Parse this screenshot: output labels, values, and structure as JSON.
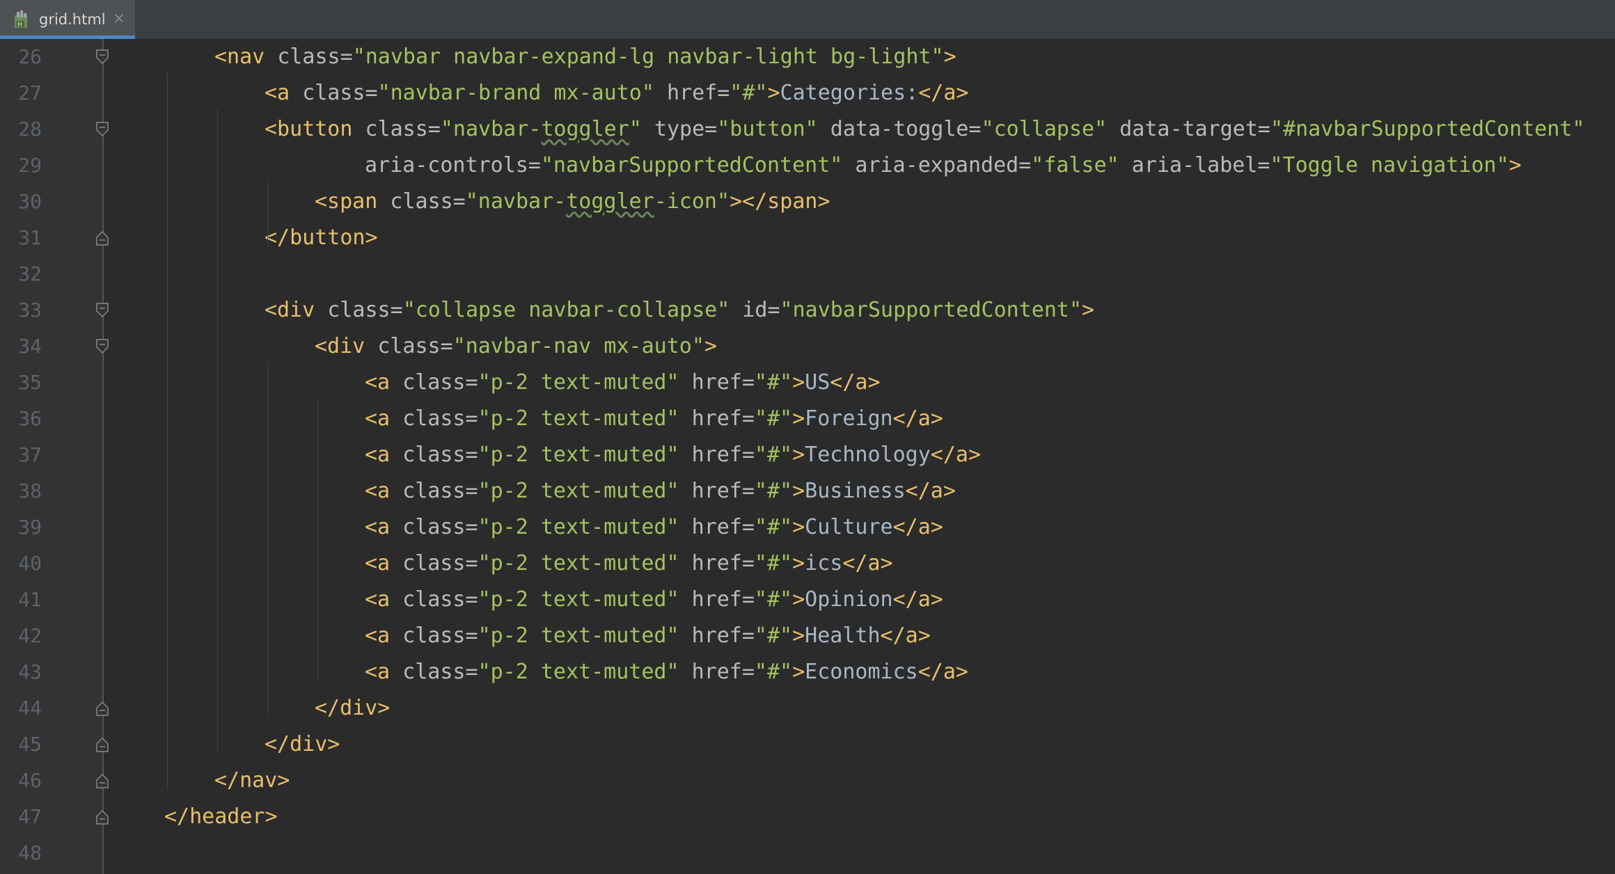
{
  "tab": {
    "file_name": "grid.html",
    "close_glyph": "×",
    "icon": "html-file-icon",
    "accent": "#4a88c7"
  },
  "lines": [
    {
      "num": "26",
      "indent": 2,
      "fold": "open",
      "tokens": [
        {
          "t": "tag",
          "v": "<nav "
        },
        {
          "t": "attr",
          "v": "class="
        },
        {
          "t": "val",
          "v": "\"navbar navbar-expand-lg navbar-light bg-light\""
        },
        {
          "t": "tag",
          "v": ">"
        }
      ]
    },
    {
      "num": "27",
      "indent": 3,
      "fold": "",
      "tokens": [
        {
          "t": "tag",
          "v": "<a "
        },
        {
          "t": "attr",
          "v": "class="
        },
        {
          "t": "val",
          "v": "\"navbar-brand mx-auto\""
        },
        {
          "t": "attr",
          "v": " href="
        },
        {
          "t": "val",
          "v": "\"#\""
        },
        {
          "t": "tag",
          "v": ">"
        },
        {
          "t": "txt",
          "v": "Categories:"
        },
        {
          "t": "tag",
          "v": "</a>"
        }
      ]
    },
    {
      "num": "28",
      "indent": 3,
      "fold": "open",
      "tokens": [
        {
          "t": "tag",
          "v": "<button "
        },
        {
          "t": "attr",
          "v": "class="
        },
        {
          "t": "val",
          "v": "\"navbar-"
        },
        {
          "t": "val-sq",
          "v": "toggler"
        },
        {
          "t": "val",
          "v": "\""
        },
        {
          "t": "attr",
          "v": " type="
        },
        {
          "t": "val",
          "v": "\"button\""
        },
        {
          "t": "attr",
          "v": " data-toggle="
        },
        {
          "t": "val",
          "v": "\"collapse\""
        },
        {
          "t": "attr",
          "v": " data-target="
        },
        {
          "t": "val",
          "v": "\"#navbarSupportedContent\""
        }
      ]
    },
    {
      "num": "29",
      "indent": 5,
      "fold": "",
      "tokens": [
        {
          "t": "attr",
          "v": "aria-controls="
        },
        {
          "t": "val",
          "v": "\"navbarSupportedContent\""
        },
        {
          "t": "attr",
          "v": " aria-expanded="
        },
        {
          "t": "val",
          "v": "\"false\""
        },
        {
          "t": "attr",
          "v": " aria-label="
        },
        {
          "t": "val",
          "v": "\"Toggle navigation\""
        },
        {
          "t": "tag",
          "v": ">"
        }
      ]
    },
    {
      "num": "30",
      "indent": 4,
      "fold": "",
      "tokens": [
        {
          "t": "tag",
          "v": "<span "
        },
        {
          "t": "attr",
          "v": "class="
        },
        {
          "t": "val",
          "v": "\"navbar-"
        },
        {
          "t": "val-sq",
          "v": "toggler"
        },
        {
          "t": "val",
          "v": "-icon\""
        },
        {
          "t": "tag",
          "v": "></span>"
        }
      ]
    },
    {
      "num": "31",
      "indent": 3,
      "fold": "close",
      "tokens": [
        {
          "t": "tag",
          "v": "</button>"
        }
      ]
    },
    {
      "num": "32",
      "indent": 0,
      "fold": "",
      "tokens": []
    },
    {
      "num": "33",
      "indent": 3,
      "fold": "open",
      "tokens": [
        {
          "t": "tag",
          "v": "<div "
        },
        {
          "t": "attr",
          "v": "class="
        },
        {
          "t": "val",
          "v": "\"collapse navbar-collapse\""
        },
        {
          "t": "attr",
          "v": " id="
        },
        {
          "t": "val",
          "v": "\"navbarSupportedContent\""
        },
        {
          "t": "tag",
          "v": ">"
        }
      ]
    },
    {
      "num": "34",
      "indent": 4,
      "fold": "open",
      "tokens": [
        {
          "t": "tag",
          "v": "<div "
        },
        {
          "t": "attr",
          "v": "class="
        },
        {
          "t": "val",
          "v": "\"navbar-nav mx-auto\""
        },
        {
          "t": "tag",
          "v": ">"
        }
      ]
    },
    {
      "num": "35",
      "indent": 5,
      "fold": "",
      "tokens": [
        {
          "t": "tag",
          "v": "<a "
        },
        {
          "t": "attr",
          "v": "class="
        },
        {
          "t": "val",
          "v": "\"p-2 text-muted\""
        },
        {
          "t": "attr",
          "v": " href="
        },
        {
          "t": "val",
          "v": "\"#\""
        },
        {
          "t": "tag",
          "v": ">"
        },
        {
          "t": "txt",
          "v": "US"
        },
        {
          "t": "tag",
          "v": "</a>"
        }
      ]
    },
    {
      "num": "36",
      "indent": 5,
      "fold": "",
      "tokens": [
        {
          "t": "tag",
          "v": "<a "
        },
        {
          "t": "attr",
          "v": "class="
        },
        {
          "t": "val",
          "v": "\"p-2 text-muted\""
        },
        {
          "t": "attr",
          "v": " href="
        },
        {
          "t": "val",
          "v": "\"#\""
        },
        {
          "t": "tag",
          "v": ">"
        },
        {
          "t": "txt",
          "v": "Foreign"
        },
        {
          "t": "tag",
          "v": "</a>"
        }
      ]
    },
    {
      "num": "37",
      "indent": 5,
      "fold": "",
      "tokens": [
        {
          "t": "tag",
          "v": "<a "
        },
        {
          "t": "attr",
          "v": "class="
        },
        {
          "t": "val",
          "v": "\"p-2 text-muted\""
        },
        {
          "t": "attr",
          "v": " href="
        },
        {
          "t": "val",
          "v": "\"#\""
        },
        {
          "t": "tag",
          "v": ">"
        },
        {
          "t": "txt",
          "v": "Technology"
        },
        {
          "t": "tag",
          "v": "</a>"
        }
      ]
    },
    {
      "num": "38",
      "indent": 5,
      "fold": "",
      "tokens": [
        {
          "t": "tag",
          "v": "<a "
        },
        {
          "t": "attr",
          "v": "class="
        },
        {
          "t": "val",
          "v": "\"p-2 text-muted\""
        },
        {
          "t": "attr",
          "v": " href="
        },
        {
          "t": "val",
          "v": "\"#\""
        },
        {
          "t": "tag",
          "v": ">"
        },
        {
          "t": "txt",
          "v": "Business"
        },
        {
          "t": "tag",
          "v": "</a>"
        }
      ]
    },
    {
      "num": "39",
      "indent": 5,
      "fold": "",
      "tokens": [
        {
          "t": "tag",
          "v": "<a "
        },
        {
          "t": "attr",
          "v": "class="
        },
        {
          "t": "val",
          "v": "\"p-2 text-muted\""
        },
        {
          "t": "attr",
          "v": " href="
        },
        {
          "t": "val",
          "v": "\"#\""
        },
        {
          "t": "tag",
          "v": ">"
        },
        {
          "t": "txt",
          "v": "Culture"
        },
        {
          "t": "tag",
          "v": "</a>"
        }
      ]
    },
    {
      "num": "40",
      "indent": 5,
      "fold": "",
      "tokens": [
        {
          "t": "tag",
          "v": "<a "
        },
        {
          "t": "attr",
          "v": "class="
        },
        {
          "t": "val",
          "v": "\"p-2 text-muted\""
        },
        {
          "t": "attr",
          "v": " href="
        },
        {
          "t": "val",
          "v": "\"#\""
        },
        {
          "t": "tag",
          "v": ">"
        },
        {
          "t": "txt",
          "v": "ics"
        },
        {
          "t": "tag",
          "v": "</a>"
        }
      ]
    },
    {
      "num": "41",
      "indent": 5,
      "fold": "",
      "tokens": [
        {
          "t": "tag",
          "v": "<a "
        },
        {
          "t": "attr",
          "v": "class="
        },
        {
          "t": "val",
          "v": "\"p-2 text-muted\""
        },
        {
          "t": "attr",
          "v": " href="
        },
        {
          "t": "val",
          "v": "\"#\""
        },
        {
          "t": "tag",
          "v": ">"
        },
        {
          "t": "txt",
          "v": "Opinion"
        },
        {
          "t": "tag",
          "v": "</a>"
        }
      ]
    },
    {
      "num": "42",
      "indent": 5,
      "fold": "",
      "tokens": [
        {
          "t": "tag",
          "v": "<a "
        },
        {
          "t": "attr",
          "v": "class="
        },
        {
          "t": "val",
          "v": "\"p-2 text-muted\""
        },
        {
          "t": "attr",
          "v": " href="
        },
        {
          "t": "val",
          "v": "\"#\""
        },
        {
          "t": "tag",
          "v": ">"
        },
        {
          "t": "txt",
          "v": "Health"
        },
        {
          "t": "tag",
          "v": "</a>"
        }
      ]
    },
    {
      "num": "43",
      "indent": 5,
      "fold": "",
      "tokens": [
        {
          "t": "tag",
          "v": "<a "
        },
        {
          "t": "attr",
          "v": "class="
        },
        {
          "t": "val",
          "v": "\"p-2 text-muted\""
        },
        {
          "t": "attr",
          "v": " href="
        },
        {
          "t": "val",
          "v": "\"#\""
        },
        {
          "t": "tag",
          "v": ">"
        },
        {
          "t": "txt",
          "v": "Economics"
        },
        {
          "t": "tag",
          "v": "</a>"
        }
      ]
    },
    {
      "num": "44",
      "indent": 4,
      "fold": "close",
      "tokens": [
        {
          "t": "tag",
          "v": "</div>"
        }
      ]
    },
    {
      "num": "45",
      "indent": 3,
      "fold": "close",
      "tokens": [
        {
          "t": "tag",
          "v": "</div>"
        }
      ]
    },
    {
      "num": "46",
      "indent": 2,
      "fold": "close",
      "tokens": [
        {
          "t": "tag",
          "v": "</nav>"
        }
      ]
    },
    {
      "num": "47",
      "indent": 1,
      "fold": "close",
      "tokens": [
        {
          "t": "tag",
          "v": "</header>"
        }
      ]
    },
    {
      "num": "48",
      "indent": 0,
      "fold": "",
      "tokens": []
    }
  ],
  "colors": {
    "background": "#2b2b2b",
    "gutter": "#313335",
    "tag": "#e8bf6a",
    "attribute": "#bababa",
    "value": "#a5c261",
    "text": "#a9b7c6",
    "line_number": "#606366"
  }
}
